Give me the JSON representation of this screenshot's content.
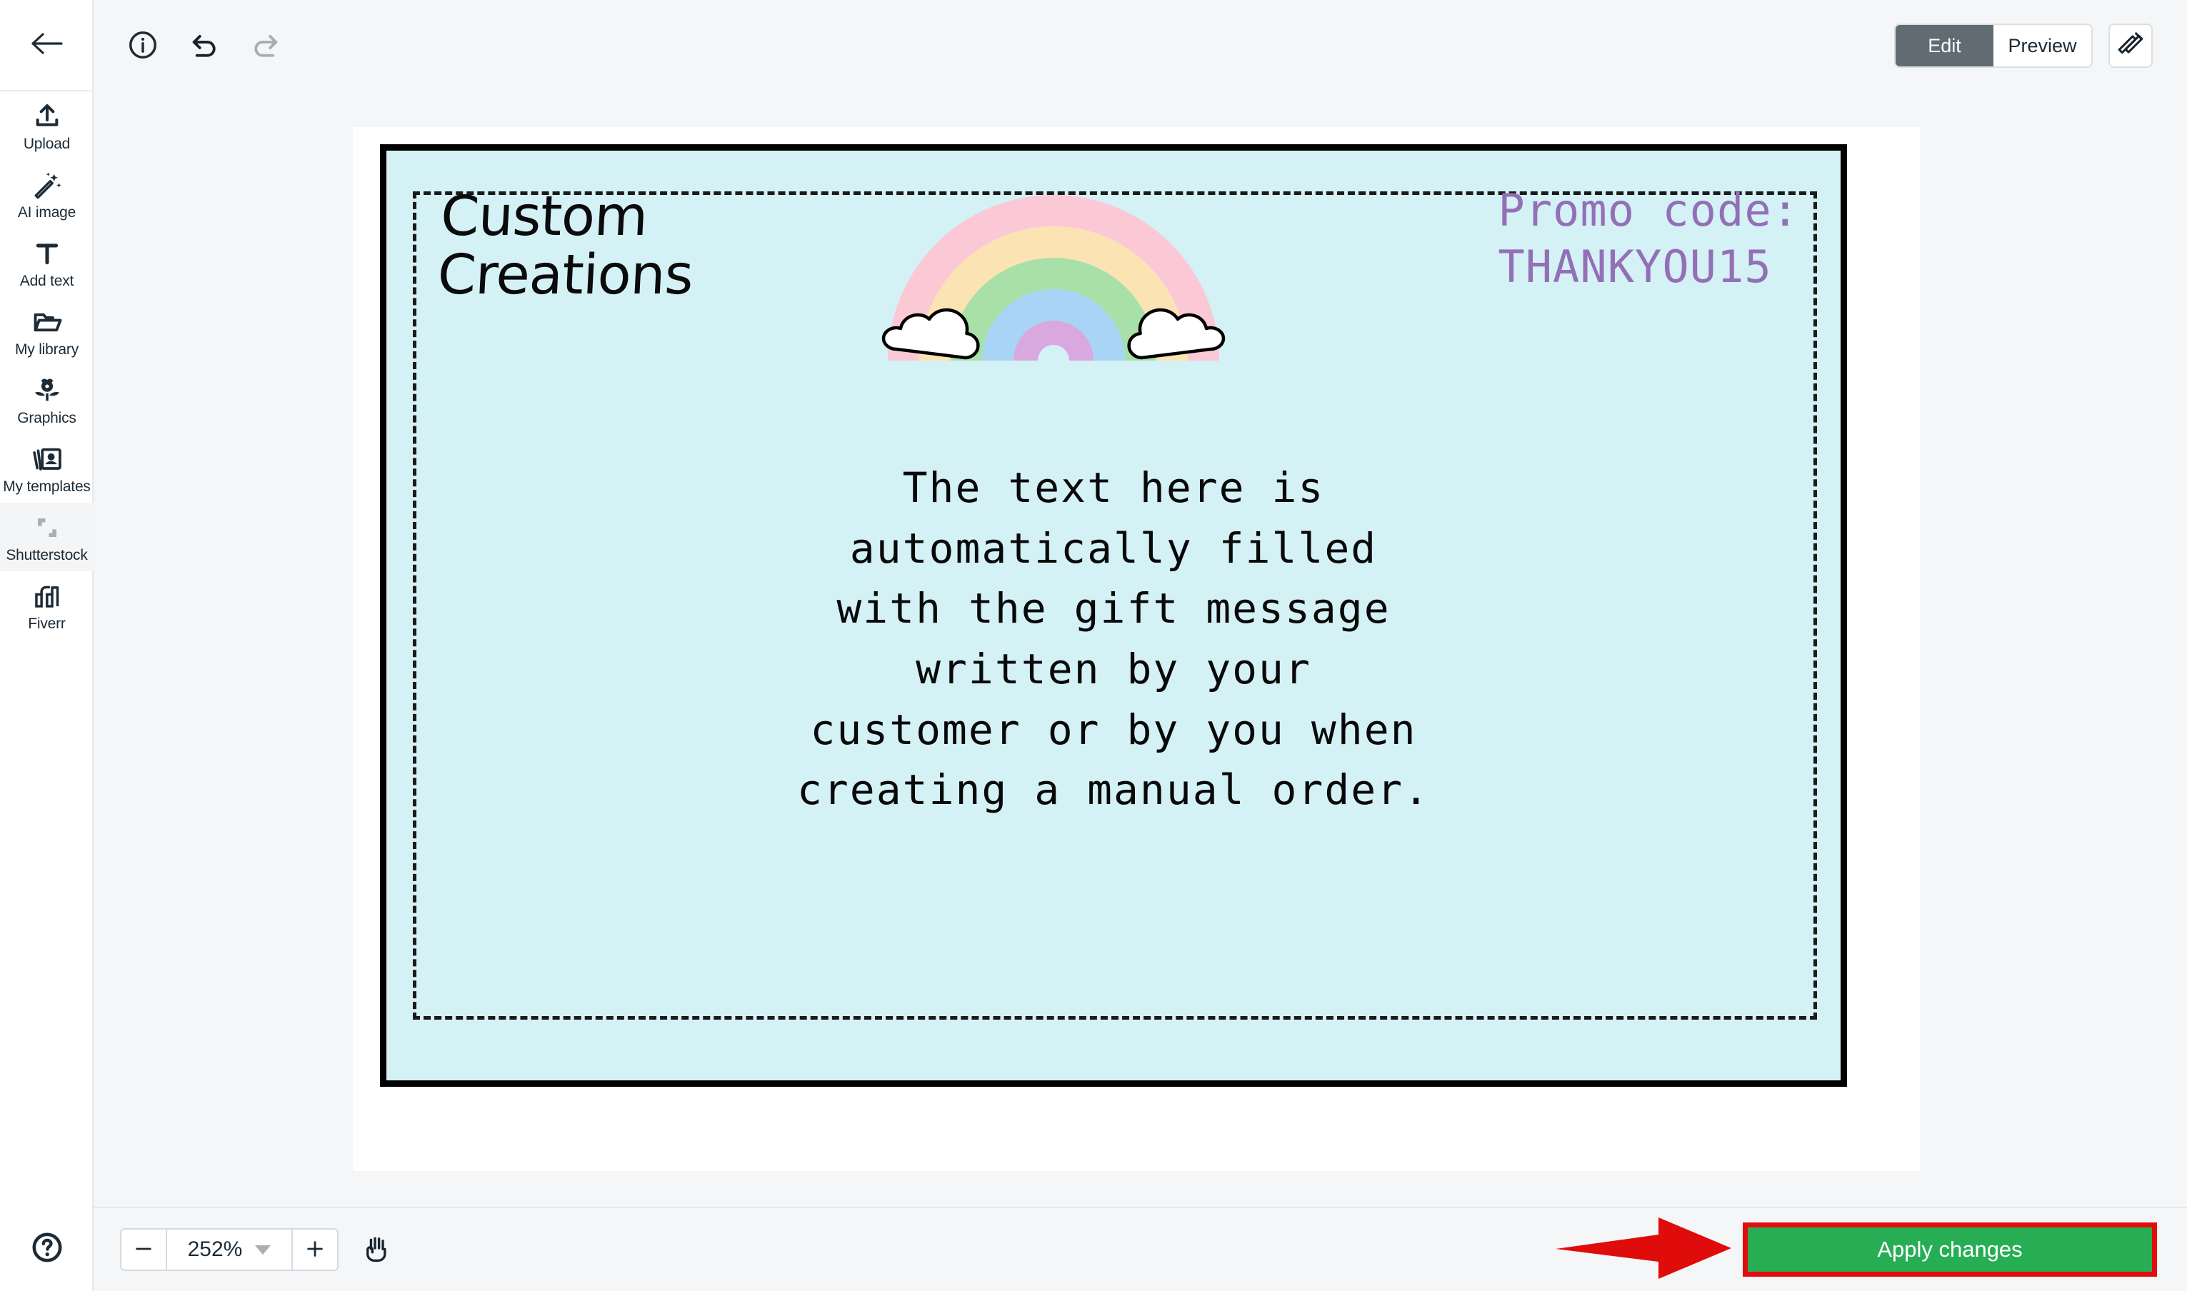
{
  "sidebar": {
    "back_icon": "back-arrow-icon",
    "items": [
      {
        "label": "Upload",
        "icon": "upload-icon",
        "active": false
      },
      {
        "label": "AI image",
        "icon": "magic-wand-icon",
        "active": false
      },
      {
        "label": "Add text",
        "icon": "text-t-icon",
        "active": false
      },
      {
        "label": "My library",
        "icon": "folder-icon",
        "active": false
      },
      {
        "label": "Graphics",
        "icon": "flower-icon",
        "active": false
      },
      {
        "label": "My templates",
        "icon": "templates-icon",
        "active": false
      },
      {
        "label": "Shutterstock",
        "icon": "shutterstock-icon",
        "active": true
      },
      {
        "label": "Fiverr",
        "icon": "fiverr-icon",
        "active": false
      }
    ],
    "help_icon": "question-circle-icon"
  },
  "toolbar": {
    "info_icon": "info-circle-icon",
    "undo_icon": "undo-icon",
    "redo_icon": "redo-icon",
    "edit_label": "Edit",
    "preview_label": "Preview",
    "selected_mode": "Edit",
    "tools_icon": "ruler-pencil-icon"
  },
  "canvas": {
    "card_background": "#d4f1f6",
    "card_border_color": "#000000",
    "title": "Custom\nCreations",
    "promo": "Promo code:\nTHANKYOU15",
    "promo_color": "#9370b5",
    "body": "The text here is\nautomatically filled\nwith the gift message\nwritten by your\ncustomer or by you when\ncreating a manual order.",
    "graphic": {
      "name": "rainbow-with-clouds-graphic",
      "bands": [
        "#fbc9d6",
        "#fce3b4",
        "#a8e0a8",
        "#a8d4f5",
        "#d9a8de"
      ],
      "cloud_fill": "#ffffff",
      "cloud_stroke": "#000000"
    }
  },
  "bottombar": {
    "zoom_out_icon": "minus-icon",
    "zoom_in_icon": "plus-icon",
    "zoom_value": "252%",
    "zoom_caret_icon": "chevron-down-icon",
    "pan_icon": "hand-icon",
    "apply_label": "Apply changes",
    "apply_bg": "#27ae55",
    "apply_border": "#e30c0c",
    "annotation_arrow": "red-arrow-annotation"
  }
}
